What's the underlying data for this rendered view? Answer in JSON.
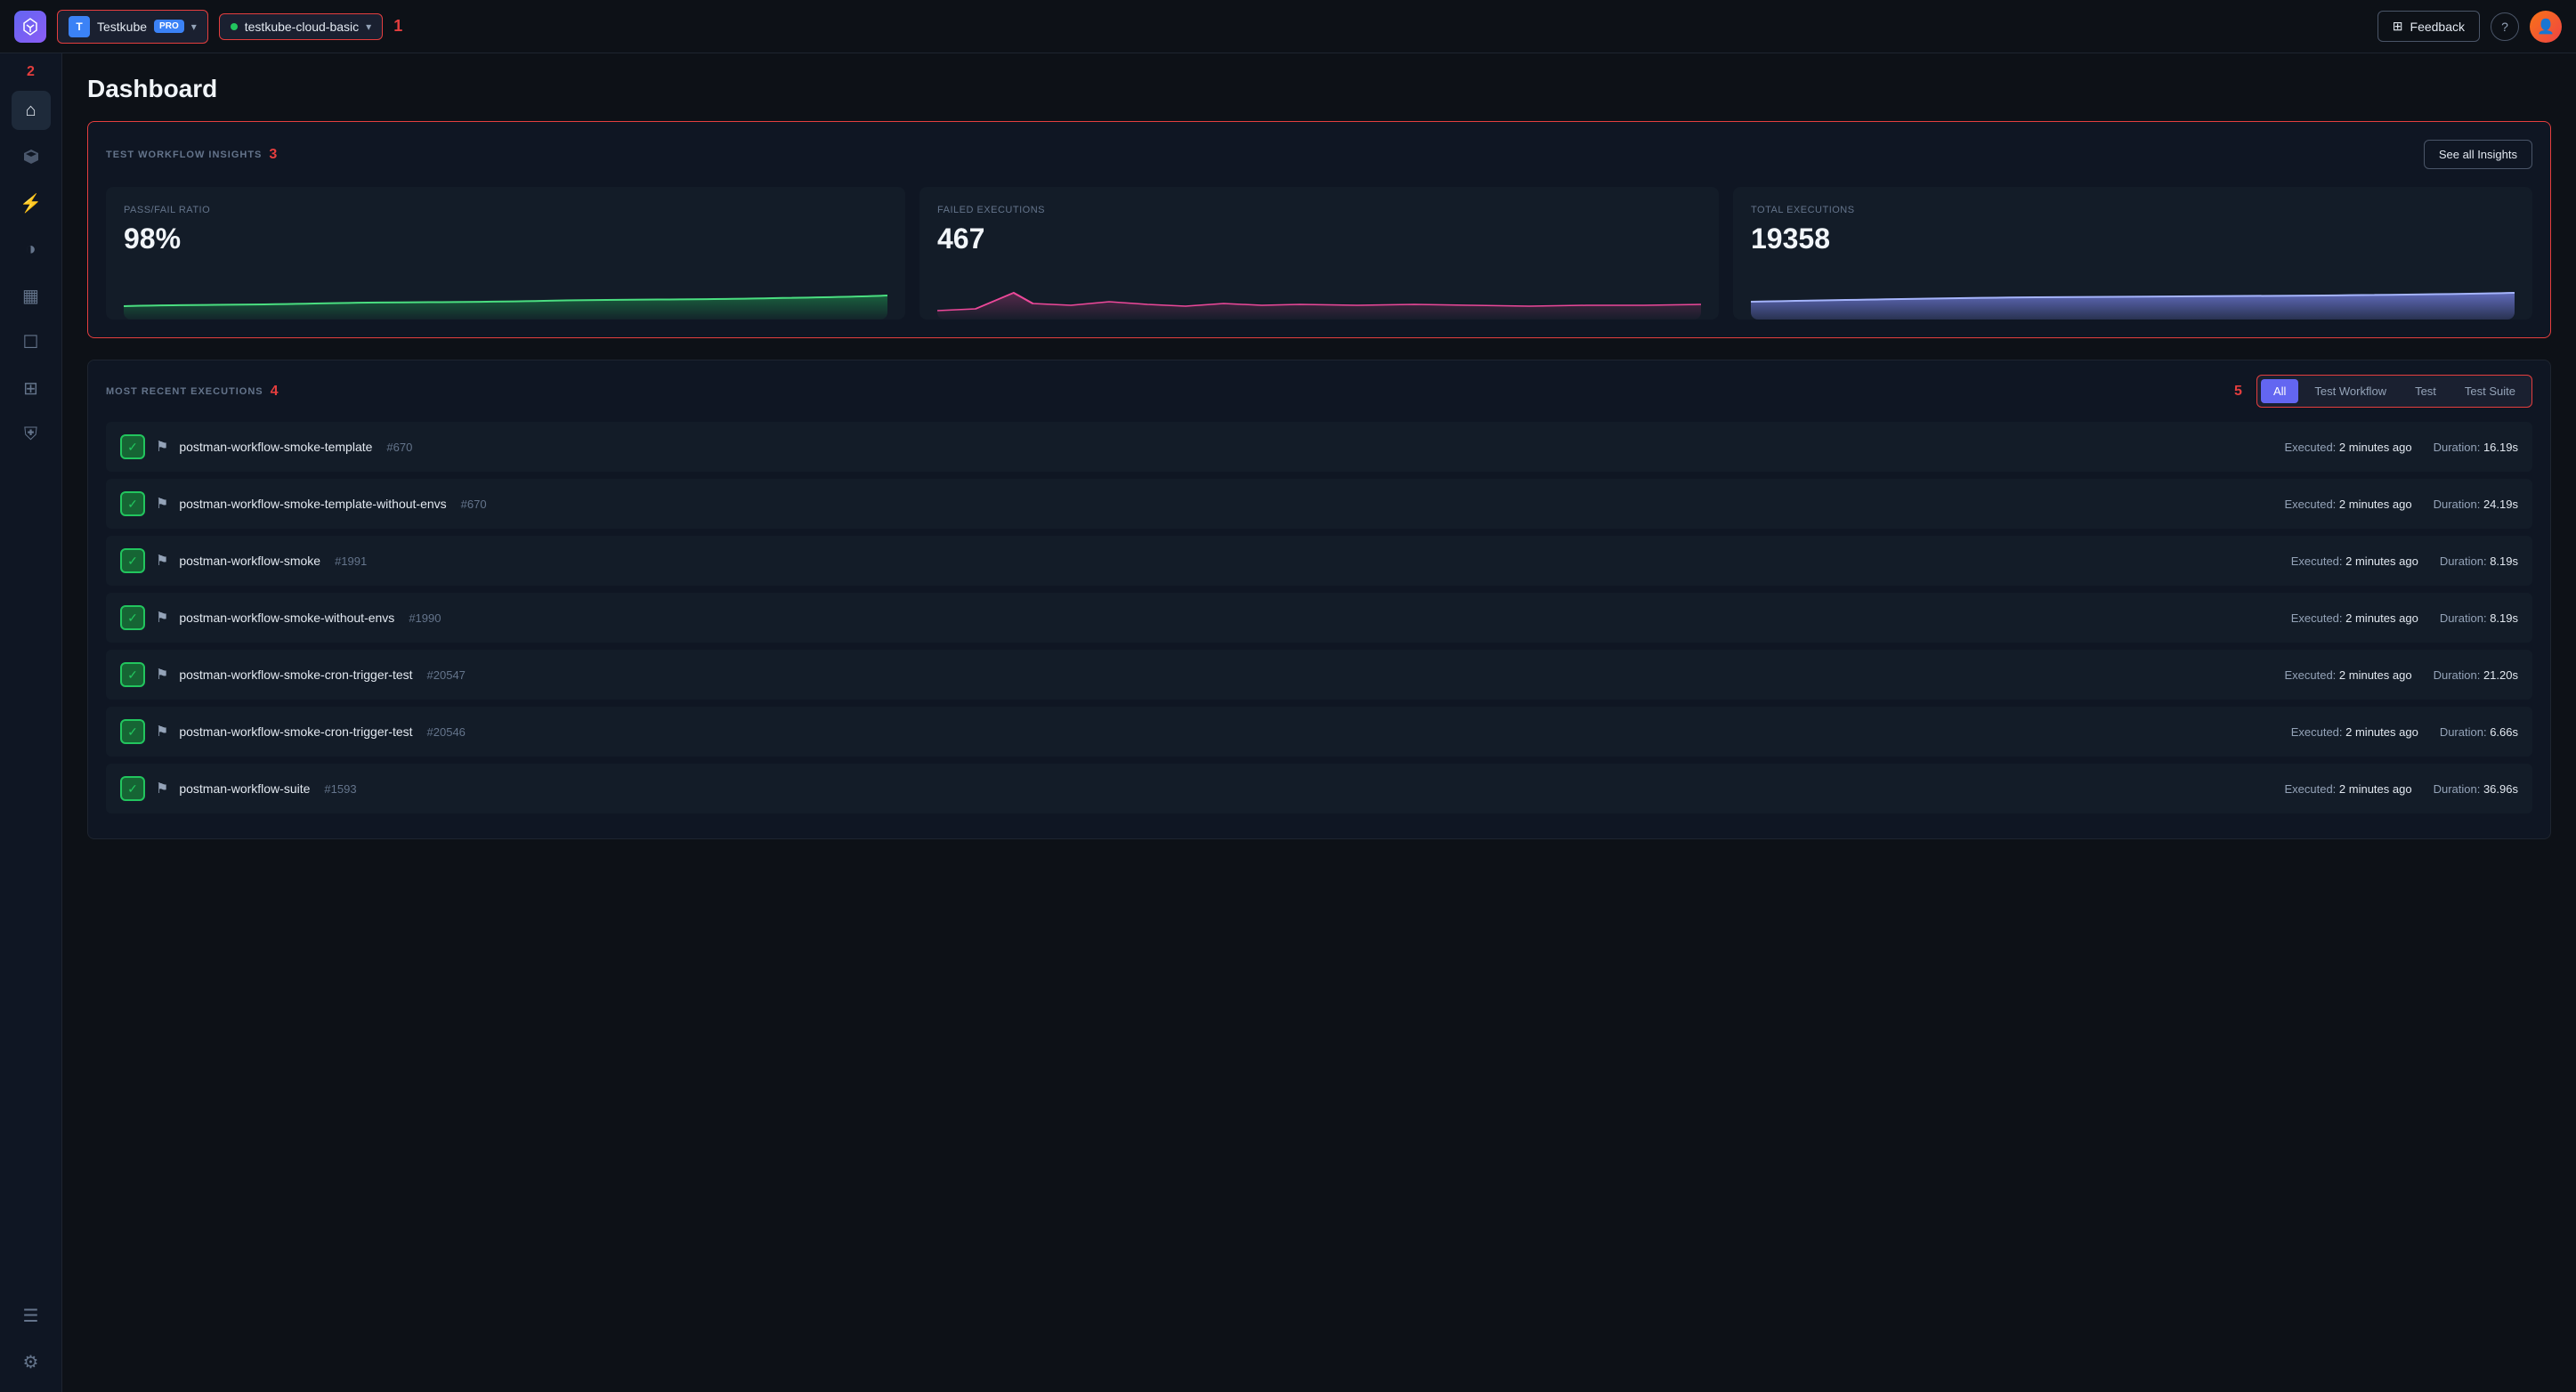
{
  "topbar": {
    "logo_char": "◆",
    "org": {
      "avatar_char": "T",
      "name": "Testkube",
      "badge": "PRO"
    },
    "env": {
      "name": "testkube-cloud-basic"
    },
    "feedback_label": "Feedback",
    "help_label": "?",
    "labels": {
      "annotation1": "1"
    }
  },
  "sidebar": {
    "items": [
      {
        "id": "home",
        "icon": "⌂",
        "active": true
      },
      {
        "id": "deploy",
        "icon": "⇄"
      },
      {
        "id": "lightning",
        "icon": "⚡"
      },
      {
        "id": "chart",
        "icon": "◑"
      },
      {
        "id": "image",
        "icon": "▦"
      },
      {
        "id": "doc",
        "icon": "☐"
      },
      {
        "id": "docs",
        "icon": "⊞"
      },
      {
        "id": "shield",
        "icon": "⛨"
      },
      {
        "id": "list",
        "icon": "☰"
      },
      {
        "id": "settings",
        "icon": "⚙"
      }
    ],
    "annotation2": "2"
  },
  "dashboard": {
    "title": "Dashboard",
    "annotation3": "3",
    "annotation4": "4",
    "annotation5": "5"
  },
  "insights": {
    "section_label": "TEST WORKFLOW INSIGHTS",
    "see_all_label": "See all Insights",
    "metrics": [
      {
        "id": "pass-fail",
        "label": "PASS/FAIL RATIO",
        "value": "98%",
        "chart_type": "green"
      },
      {
        "id": "failed-exec",
        "label": "FAILED EXECUTIONS",
        "value": "467",
        "chart_type": "pink"
      },
      {
        "id": "total-exec",
        "label": "TOTAL EXECUTIONS",
        "value": "19358",
        "chart_type": "blue"
      }
    ]
  },
  "executions": {
    "section_label": "MOST RECENT EXECUTIONS",
    "filters": [
      {
        "id": "all",
        "label": "All",
        "active": true
      },
      {
        "id": "test-workflow",
        "label": "Test Workflow",
        "active": false
      },
      {
        "id": "test",
        "label": "Test",
        "active": false
      },
      {
        "id": "test-suite",
        "label": "Test Suite",
        "active": false
      }
    ],
    "rows": [
      {
        "name": "postman-workflow-smoke-template",
        "id": "#670",
        "executed": "2 minutes ago",
        "duration": "16.19s",
        "status": "pass"
      },
      {
        "name": "postman-workflow-smoke-template-without-envs",
        "id": "#670",
        "executed": "2 minutes ago",
        "duration": "24.19s",
        "status": "pass"
      },
      {
        "name": "postman-workflow-smoke",
        "id": "#1991",
        "executed": "2 minutes ago",
        "duration": "8.19s",
        "status": "pass"
      },
      {
        "name": "postman-workflow-smoke-without-envs",
        "id": "#1990",
        "executed": "2 minutes ago",
        "duration": "8.19s",
        "status": "pass"
      },
      {
        "name": "postman-workflow-smoke-cron-trigger-test",
        "id": "#20547",
        "executed": "2 minutes ago",
        "duration": "21.20s",
        "status": "pass"
      },
      {
        "name": "postman-workflow-smoke-cron-trigger-test",
        "id": "#20546",
        "executed": "2 minutes ago",
        "duration": "6.66s",
        "status": "pass"
      },
      {
        "name": "postman-workflow-suite",
        "id": "#1593",
        "executed": "2 minutes ago",
        "duration": "36.96s",
        "status": "pass"
      }
    ]
  }
}
